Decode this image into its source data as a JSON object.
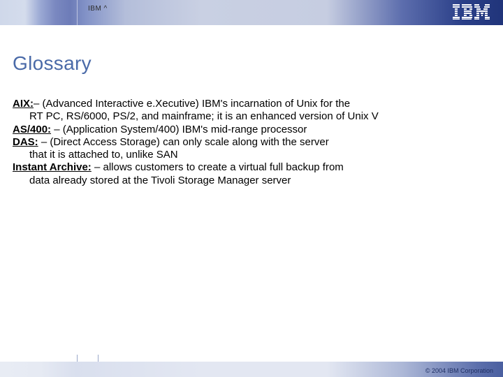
{
  "header": {
    "small_label": "IBM ^"
  },
  "title": "Glossary",
  "entries": [
    {
      "term": "AIX:",
      "first_line": "– (Advanced Interactive e.Xecutive) IBM's incarnation of Unix for the",
      "rest": "RT PC, RS/6000, PS/2, and mainframe; it is an enhanced version of Unix V"
    },
    {
      "term": "AS/400:",
      "first_line": " – (Application System/400) IBM's mid-range processor",
      "rest": ""
    },
    {
      "term": "DAS:",
      "first_line": " – (Direct Access Storage) can only scale along with the server",
      "rest": "that it is attached to, unlike SAN"
    },
    {
      "term": "Instant Archive:",
      "first_line": " – allows customers to create a virtual full backup from",
      "rest": "data already stored at the Tivoli Storage Manager server"
    }
  ],
  "footer": {
    "copyright": "© 2004 IBM Corporation"
  }
}
